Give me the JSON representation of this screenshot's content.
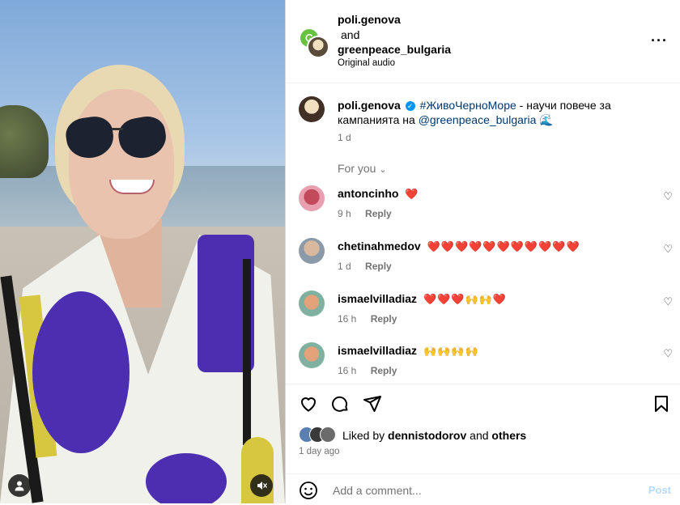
{
  "header": {
    "user1": "poli.genova",
    "and": "and",
    "user2": "greenpeace_bulgaria",
    "audio": "Original audio",
    "more_icon": "more-horizontal-icon"
  },
  "caption": {
    "user": "poli.genova",
    "hashtag": "#ЖивоЧерноМоре",
    "text": " - научи повече за кампанията на ",
    "mention": "@greenpeace_bulgaria",
    "emoji": "🌊",
    "time": "1 d"
  },
  "for_you": "For you",
  "comments": [
    {
      "user": "antoncinho",
      "text": "❤️",
      "time": "9 h",
      "reply": "Reply"
    },
    {
      "user": "chetinahmedov",
      "text": "❤️❤️❤️❤️❤️❤️❤️❤️❤️❤️❤️",
      "time": "1 d",
      "reply": "Reply"
    },
    {
      "user": "ismaelvilladiaz",
      "text": "❤️❤️❤️🙌🙌❤️",
      "time": "16 h",
      "reply": "Reply"
    },
    {
      "user": "ismaelvilladiaz",
      "text": "🙌🙌🙌🙌",
      "time": "16 h",
      "reply": "Reply"
    }
  ],
  "likes": {
    "prefix": "Liked by ",
    "user": "dennistodorov",
    "middle": " and ",
    "others": "others"
  },
  "post_time": "1 day ago",
  "add_comment": {
    "placeholder": "Add a comment...",
    "post_label": "Post"
  },
  "colors": {
    "verified": "#0095f6",
    "link": "#00376b",
    "post_disabled": "#b3dbff"
  }
}
